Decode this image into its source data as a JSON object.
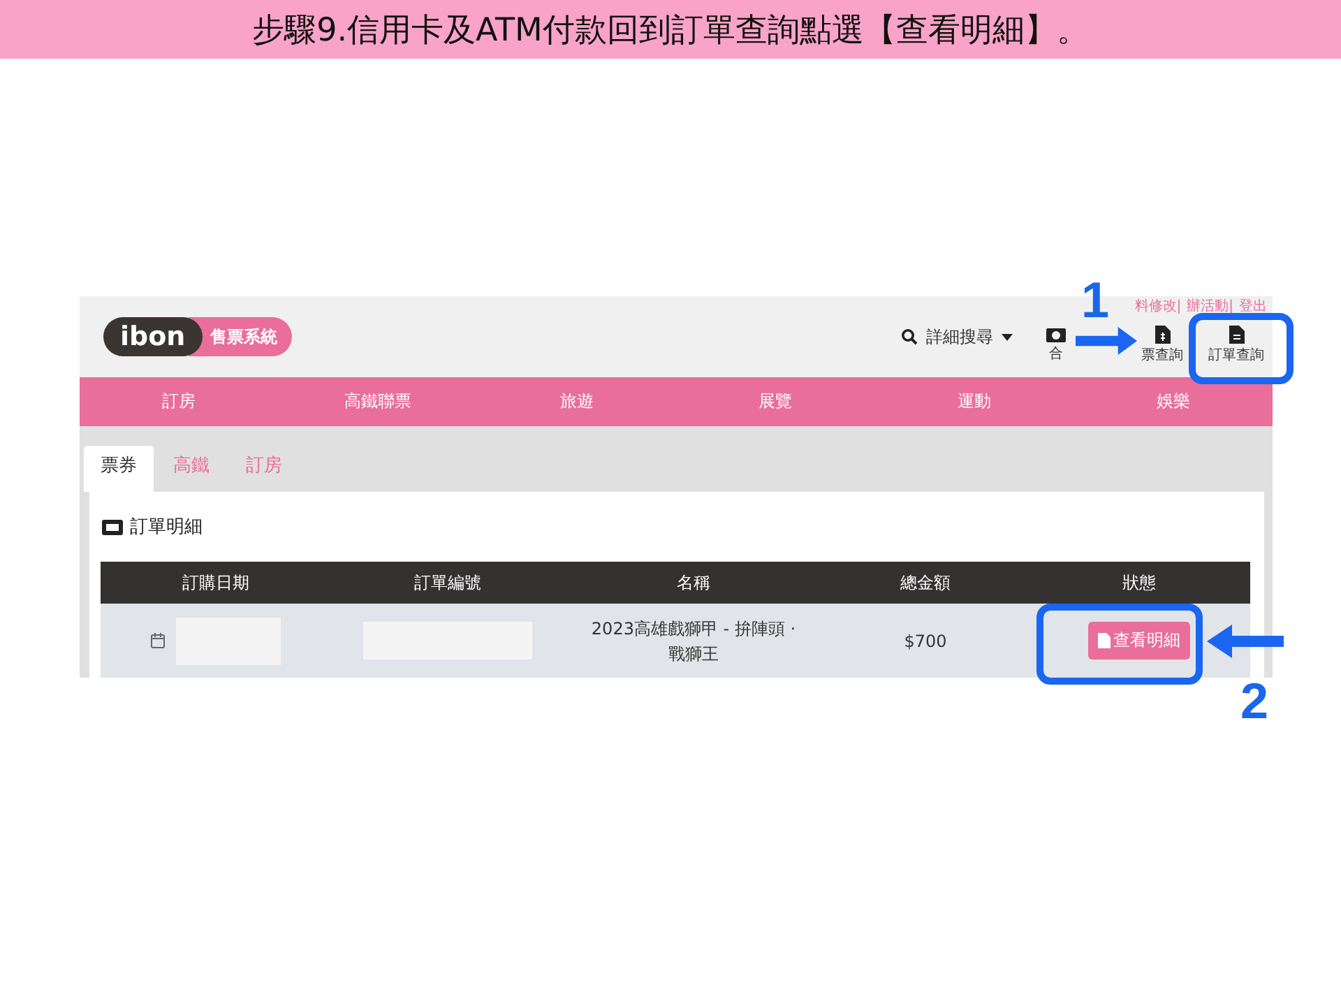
{
  "slide_title": "步驟9.信用卡及ATM付款回到訂單查詢點選【查看明細】。",
  "header": {
    "logo": {
      "mark": "ibon",
      "badge": "售票系統"
    },
    "search": "詳細搜尋",
    "account_links": [
      "料修改|",
      "辦活動|",
      "登出"
    ],
    "tools": [
      {
        "label": "合",
        "kind": "camera"
      },
      {
        "label": "票查詢",
        "kind": "money"
      },
      {
        "label": "訂單查詢",
        "kind": "doc"
      }
    ]
  },
  "nav": [
    "訂房",
    "高鐵聯票",
    "旅遊",
    "展覽",
    "運動",
    "娛樂"
  ],
  "tabs": [
    {
      "label": "票券",
      "selected": true
    },
    {
      "label": "高鐵",
      "selected": false
    },
    {
      "label": "訂房",
      "selected": false
    }
  ],
  "section_title": "訂單明細",
  "table": {
    "columns": [
      "訂購日期",
      "訂單編號",
      "名稱",
      "總金額",
      "狀態"
    ],
    "rows": [
      {
        "name": "2023高雄戲獅甲 - 拚陣頭 · 戰獅王",
        "total": "$700",
        "action": "查看明細"
      }
    ]
  },
  "annotations": [
    "1",
    "2"
  ]
}
